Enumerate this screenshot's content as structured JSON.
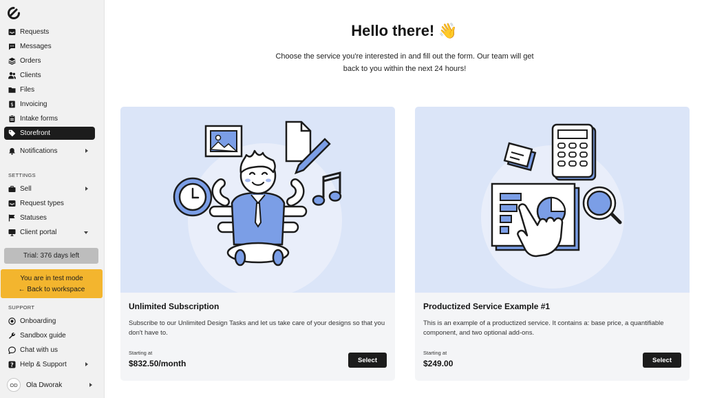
{
  "sidebar": {
    "items": [
      {
        "label": "Requests",
        "icon": "inbox-icon"
      },
      {
        "label": "Messages",
        "icon": "message-icon"
      },
      {
        "label": "Orders",
        "icon": "layers-icon"
      },
      {
        "label": "Clients",
        "icon": "users-icon"
      },
      {
        "label": "Files",
        "icon": "folder-icon"
      },
      {
        "label": "Invoicing",
        "icon": "invoice-icon"
      },
      {
        "label": "Intake forms",
        "icon": "clipboard-icon"
      },
      {
        "label": "Storefront",
        "icon": "tag-icon"
      },
      {
        "label": "Notifications",
        "icon": "bell-icon"
      }
    ],
    "settings_label": "SETTINGS",
    "settings": [
      {
        "label": "Sell",
        "icon": "briefcase-icon"
      },
      {
        "label": "Request types",
        "icon": "inbox-icon"
      },
      {
        "label": "Statuses",
        "icon": "flag-icon"
      },
      {
        "label": "Client portal",
        "icon": "monitor-icon"
      }
    ],
    "trial_text": "Trial: 376 days left",
    "test_mode_text": "You are in test mode",
    "back_text": "Back to workspace",
    "support_label": "SUPPORT",
    "support": [
      {
        "label": "Onboarding",
        "icon": "target-icon"
      },
      {
        "label": "Sandbox guide",
        "icon": "wrench-icon"
      },
      {
        "label": "Chat with us",
        "icon": "chat-icon"
      },
      {
        "label": "Help & Support",
        "icon": "help-icon"
      }
    ],
    "user": {
      "initials": "OD",
      "name": "Ola Dworak"
    }
  },
  "main": {
    "title": "Hello there! 👋",
    "intro": "Choose the service you're interested in and fill out the form. Our team will get back to you within the next 24 hours!",
    "cards": [
      {
        "name": "Unlimited Subscription",
        "description": "Subscribe to our Unlimited Design Tasks and let us take care of your designs so that you don't have to.",
        "starting_label": "Starting at",
        "price": "$832.50/month",
        "button": "Select"
      },
      {
        "name": "Productized Service Example #1",
        "description": "This is an example of a productized service. It contains a: base price, a quantifiable component, and two optional add-ons.",
        "starting_label": "Starting at",
        "price": "$249.00",
        "button": "Select"
      }
    ]
  },
  "colors": {
    "accent_blue": "#7b9ee6",
    "hero_bg": "#dbe5f8",
    "active_nav": "#1c1c1c",
    "test_mode": "#f3b52e",
    "trial_bg": "#bdbdbd"
  }
}
